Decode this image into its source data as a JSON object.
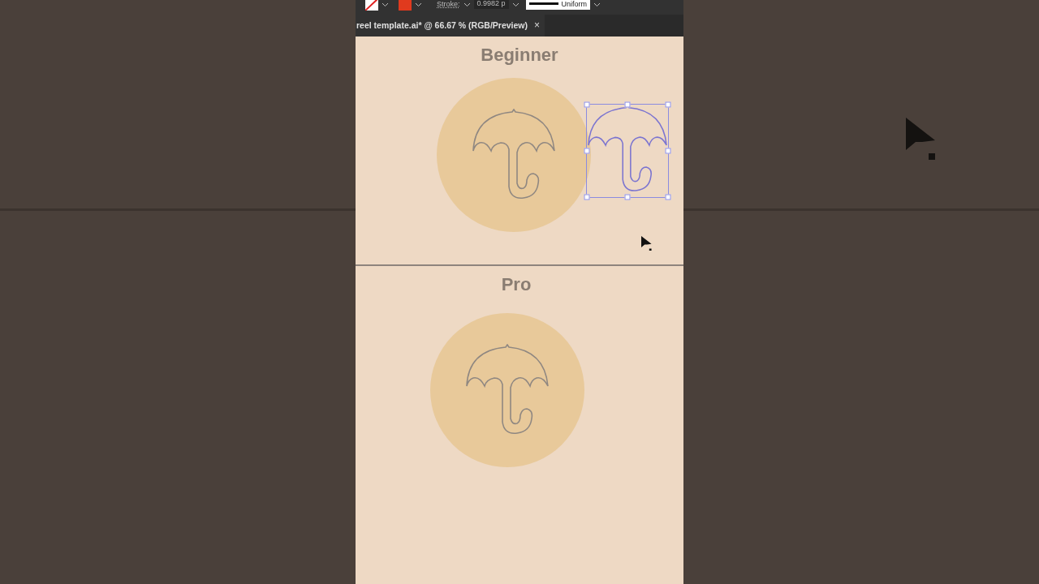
{
  "toolbar": {
    "stroke_label": "Stroke:",
    "stroke_weight": "0.9982 p",
    "profile": "Uniform"
  },
  "document_tab": {
    "title": "reel template.ai* @ 66.67 % (RGB/Preview)",
    "close": "×"
  },
  "sections": [
    {
      "title": "Beginner",
      "selected_copy": true
    },
    {
      "title": "Pro",
      "selected_copy": false
    }
  ]
}
